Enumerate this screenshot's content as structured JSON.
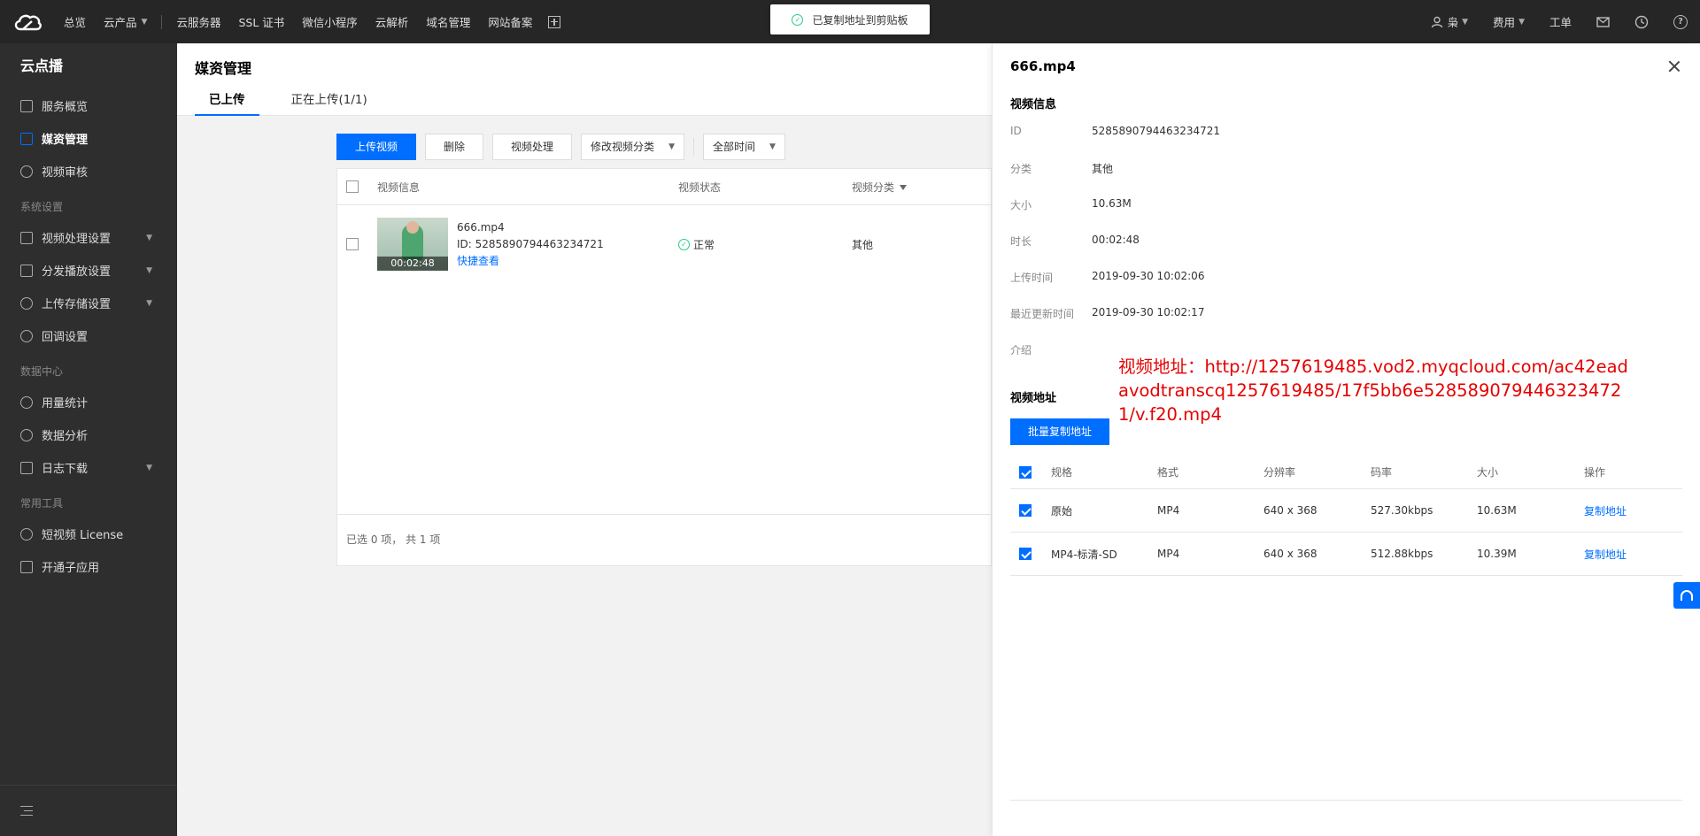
{
  "topbar": {
    "nav": [
      "总览",
      "云产品",
      "云服务器",
      "SSL 证书",
      "微信小程序",
      "云解析",
      "域名管理",
      "网站备案"
    ],
    "user": "枭",
    "billing": "费用",
    "ticket": "工单"
  },
  "toast": {
    "message": "已复制地址到剪贴板"
  },
  "sidebar": {
    "title": "云点播",
    "items1": [
      "服务概览",
      "媒资管理",
      "视频审核"
    ],
    "group_system": "系统设置",
    "items2": [
      "视频处理设置",
      "分发播放设置",
      "上传存储设置",
      "回调设置"
    ],
    "group_data": "数据中心",
    "items3": [
      "用量统计",
      "数据分析",
      "日志下载"
    ],
    "group_tools": "常用工具",
    "items4": [
      "短视频 License",
      "开通子应用"
    ]
  },
  "main": {
    "title": "媒资管理",
    "tabs": [
      "已上传",
      "正在上传(1/1)"
    ],
    "toolbar": {
      "upload": "上传视频",
      "delete": "删除",
      "process": "视频处理",
      "category": "修改视频分类",
      "time": "全部时间"
    },
    "table": {
      "headers": [
        "视频信息",
        "视频状态",
        "视频分类"
      ],
      "row": {
        "name": "666.mp4",
        "id": "ID: 5285890794463234721",
        "quick_view": "快捷查看",
        "duration": "00:02:48",
        "status": "正常",
        "category": "其他"
      },
      "footer": "已选 0 项，  共 1 项"
    }
  },
  "panel": {
    "title": "666.mp4",
    "info_title": "视频信息",
    "info": [
      {
        "k": "ID",
        "v": "5285890794463234721"
      },
      {
        "k": "分类",
        "v": "其他"
      },
      {
        "k": "大小",
        "v": "10.63M"
      },
      {
        "k": "时长",
        "v": "00:02:48"
      },
      {
        "k": "上传时间",
        "v": "2019-09-30 10:02:06"
      },
      {
        "k": "最近更新时间",
        "v": "2019-09-30 10:02:17"
      },
      {
        "k": "介绍",
        "v": ""
      }
    ],
    "url_title": "视频地址",
    "copy_all": "批量复制地址",
    "annotation": "视频地址：http://1257619485.vod2.myqcloud.com/ac42eadavodtranscq1257619485/17f5bb6e5285890794463234721/v.f20.mp4",
    "table_headers": [
      "规格",
      "格式",
      "分辨率",
      "码率",
      "大小",
      "操作"
    ],
    "rows": [
      {
        "spec": "原始",
        "format": "MP4",
        "res": "640 x 368",
        "rate": "527.30kbps",
        "size": "10.63M",
        "op": "复制地址"
      },
      {
        "spec": "MP4-标清-SD",
        "format": "MP4",
        "res": "640 x 368",
        "rate": "512.88kbps",
        "size": "10.39M",
        "op": "复制地址"
      }
    ]
  }
}
